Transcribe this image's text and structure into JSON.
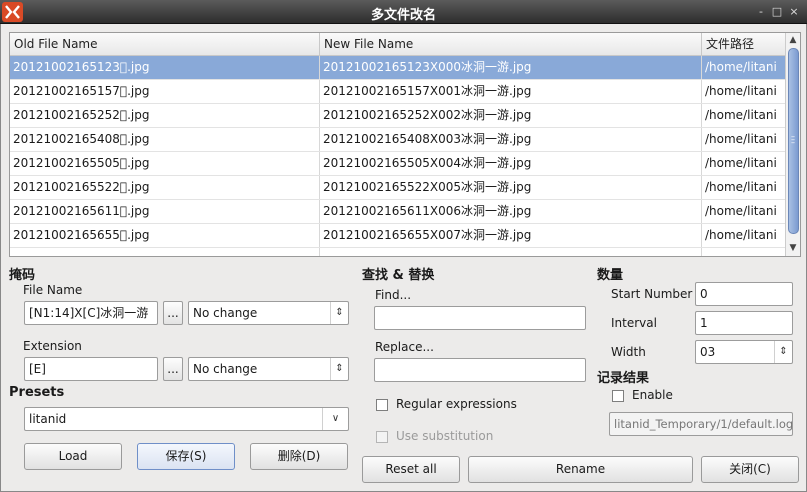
{
  "window": {
    "title": "多文件改名",
    "controls": [
      "-",
      "□",
      "×"
    ]
  },
  "table": {
    "columns": [
      "Old File Name",
      "New File Name",
      "文件路径"
    ],
    "rows": [
      {
        "old": "20121002165123\u0000.jpg",
        "new": "20121002165123X000冰洞一游.jpg",
        "path": "/home/litani"
      },
      {
        "old": "20121002165157\u0000.jpg",
        "new": "20121002165157X001冰洞一游.jpg",
        "path": "/home/litani"
      },
      {
        "old": "20121002165252\u0000.jpg",
        "new": "20121002165252X002冰洞一游.jpg",
        "path": "/home/litani"
      },
      {
        "old": "20121002165408\u0000.jpg",
        "new": "20121002165408X003冰洞一游.jpg",
        "path": "/home/litani"
      },
      {
        "old": "20121002165505\u0000.jpg",
        "new": "20121002165505X004冰洞一游.jpg",
        "path": "/home/litani"
      },
      {
        "old": "20121002165522\u0000.jpg",
        "new": "20121002165522X005冰洞一游.jpg",
        "path": "/home/litani"
      },
      {
        "old": "20121002165611\u0000.jpg",
        "new": "20121002165611X006冰洞一游.jpg",
        "path": "/home/litani"
      },
      {
        "old": "20121002165655\u0000.jpg",
        "new": "20121002165655X007冰洞一游.jpg",
        "path": "/home/litani"
      }
    ]
  },
  "mask": {
    "title": "掩码",
    "file_name_label": "File Name",
    "file_name_value": "[N1:14]X[C]冰洞一游",
    "file_name_case": "No change",
    "extension_label": "Extension",
    "extension_value": "[E]",
    "extension_case": "No change",
    "ellipsis": "..."
  },
  "presets": {
    "title": "Presets",
    "selected": "litanid",
    "load": "Load",
    "save": "保存(S)",
    "delete": "删除(D)"
  },
  "find_replace": {
    "title": "查找 & 替换",
    "find_label": "Find...",
    "find_value": "",
    "replace_label": "Replace...",
    "replace_value": "",
    "regex_label": "Regular expressions",
    "substitution_label": "Use substitution"
  },
  "number": {
    "title": "数量",
    "start_label": "Start Number",
    "start_value": "0",
    "interval_label": "Interval",
    "interval_value": "1",
    "width_label": "Width",
    "width_value": "03"
  },
  "log": {
    "title": "记录结果",
    "enable_label": "Enable",
    "path": "litanid_Temporary/1/default.log"
  },
  "buttons": {
    "reset": "Reset all",
    "rename": "Rename",
    "close": "关闭(C)"
  },
  "colors": {
    "selection": "#89a9d8",
    "titlebar": "#3a3a3a",
    "app_icon": "#d94a26"
  }
}
